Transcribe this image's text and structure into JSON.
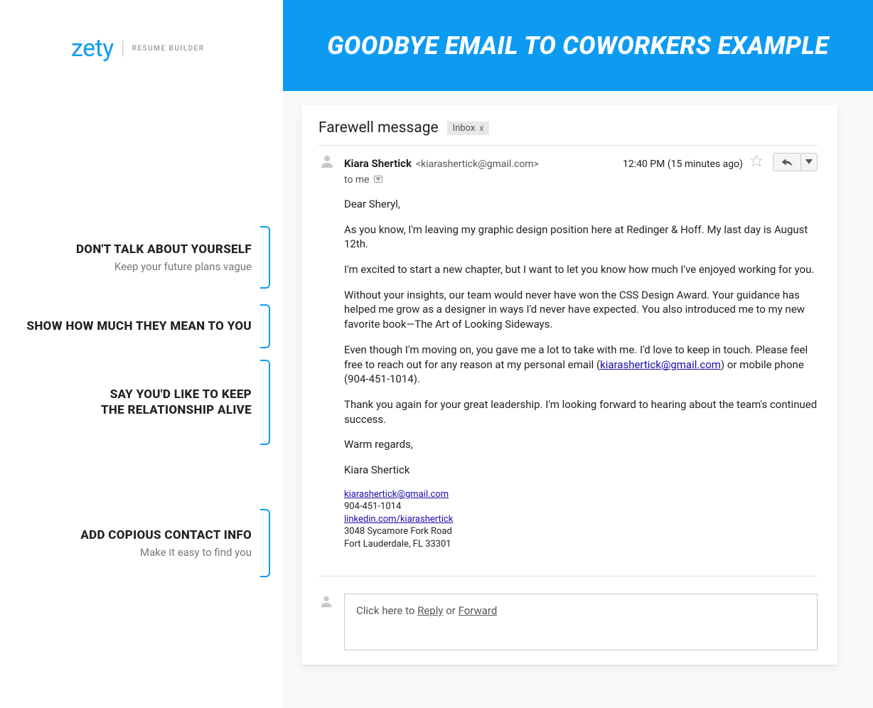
{
  "logo": {
    "brand": "zety",
    "sub": "RESUME BUILDER"
  },
  "header": {
    "title": "GOODBYE EMAIL TO COWORKERS EXAMPLE"
  },
  "email": {
    "subject": "Farewell message",
    "label": "Inbox",
    "sender_name": "Kiara Shertick",
    "sender_email": "<kiarashertick@gmail.com>",
    "timestamp": "12:40 PM (15 minutes ago)",
    "to": "to me",
    "greeting": "Dear Sheryl,",
    "p1": "As you know, I'm leaving my graphic design position here at Redinger & Hoff. My last day is August 12th.",
    "p2": "I'm excited to start a new chapter, but I want to let you know how much I've enjoyed working for you.",
    "p3": "Without your insights, our team would never have won the CSS Design Award. Your guidance has helped me grow as a designer in ways I'd never have expected. You also introduced me to my new favorite book—The Art of Looking Sideways.",
    "p4a": "Even though I'm moving on, you gave me a lot to take with me. I'd love to keep in touch.  Please feel free to reach out for any reason at my personal email (",
    "p4_link": "kiarashertick@gmail.com",
    "p4b": ") or mobile phone (904-451-1014).",
    "p5": "Thank you again for your great leadership. I'm looking forward to hearing about the team's continued success.",
    "regards": "Warm regards,",
    "sign_name": "Kiara Shertick",
    "sig": {
      "email": "kiarashertick@gmail.com",
      "phone": "904-451-1014",
      "linkedin": "linkedin.com/kiarashertick",
      "addr1": "3048 Sycamore Fork Road",
      "addr2": "Fort Lauderdale, FL 33301"
    },
    "reply_prefix": "Click here to ",
    "reply_word": "Reply",
    "reply_or": " or ",
    "forward_word": "Forward"
  },
  "annotations": [
    {
      "title": "DON'T TALK ABOUT YOURSELF",
      "sub": "Keep your future plans vague"
    },
    {
      "title": "SHOW HOW MUCH THEY MEAN TO YOU",
      "sub": ""
    },
    {
      "title_l1": "SAY YOU'D LIKE TO KEEP",
      "title_l2": "THE RELATIONSHIP ALIVE",
      "sub": ""
    },
    {
      "title": "ADD COPIOUS CONTACT INFO",
      "sub": "Make it easy to find you"
    }
  ]
}
